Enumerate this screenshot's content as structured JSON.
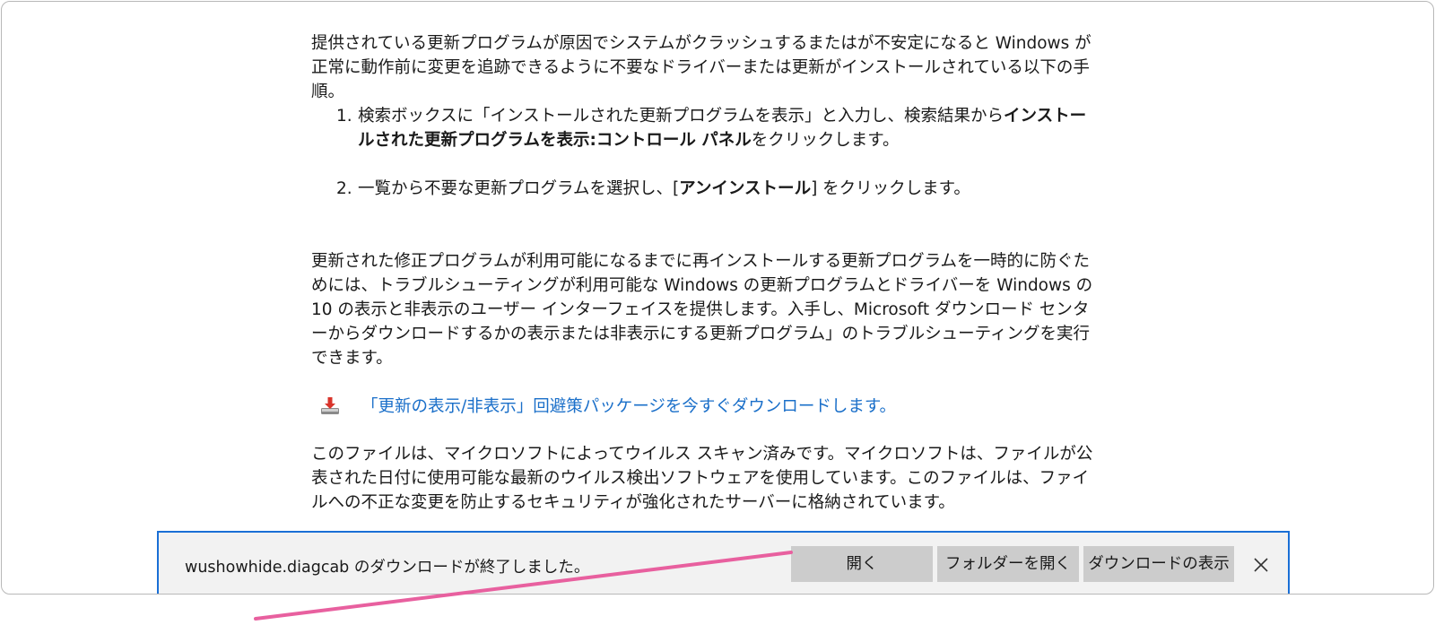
{
  "article": {
    "intro": "提供されている更新プログラムが原因でシステムがクラッシュするまたはが不安定になると Windows が正常に動作前に変更を追跡できるように不要なドライバーまたは更新がインストールされている以下の手順。",
    "steps": [
      {
        "num": "1.",
        "text_before": "検索ボックスに「インストールされた更新プログラムを表示」と入力し、検索結果から",
        "bold": "インストールされた更新プログラムを表示:コントロール パネル",
        "text_after": "をクリックします。"
      },
      {
        "num": "2.",
        "text_before": "一覧から不要な更新プログラムを選択し、[",
        "bold": "アンインストール",
        "text_after": "] をクリックします。"
      }
    ],
    "para2": "更新された修正プログラムが利用可能になるまでに再インストールする更新プログラムを一時的に防ぐためには、トラブルシューティングが利用可能な Windows の更新プログラムとドライバーを Windows の 10 の表示と非表示のユーザー インターフェイスを提供します。入手し、Microsoft ダウンロード センターからダウンロードするかの表示または非表示にする更新プログラム」のトラブルシューティングを実行できます。",
    "download_link": "「更新の表示/非表示」回避策パッケージを今すぐダウンロードします。",
    "para3": "このファイルは、マイクロソフトによってウイルス スキャン済みです。マイクロソフトは、ファイルが公表された日付に使用可能な最新のウイルス検出ソフトウェアを使用しています。このファイルは、ファイルへの不正な変更を防止するセキュリティが強化されたサーバーに格納されています。"
  },
  "download_bar": {
    "message": "wushowhide.diagcab のダウンロードが終了しました。",
    "open_label": "開く",
    "open_folder_label": "フォルダーを開く",
    "view_downloads_label": "ダウンロードの表示",
    "close_icon": "close-icon"
  },
  "colors": {
    "link": "#1a6fc9",
    "bar_border": "#1a6fd6",
    "annotation": "#e8609f"
  }
}
